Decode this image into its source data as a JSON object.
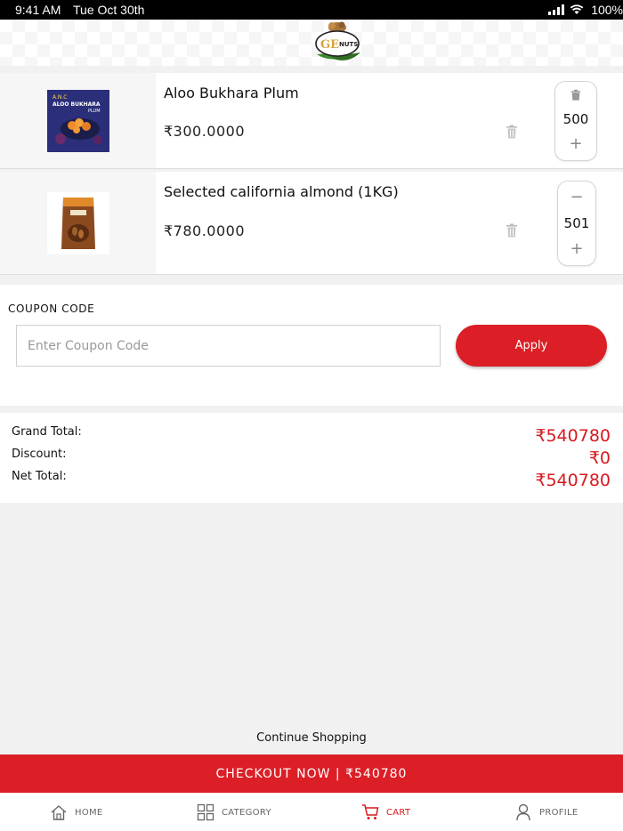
{
  "status_bar": {
    "time": "9:41 AM",
    "date": "Tue Oct 30th",
    "battery": "100%"
  },
  "header": {
    "logo_text": "NUTS"
  },
  "cart": {
    "items": [
      {
        "name": "Aloo Bukhara Plum",
        "price": "₹300.0000",
        "quantity": "500",
        "thumb_text_1": "A.N.C",
        "thumb_text_2": "ALOO BUKHARA",
        "thumb_text_3": "PLUM"
      },
      {
        "name": "Selected california almond (1KG)",
        "price": "₹780.0000",
        "quantity": "501"
      }
    ]
  },
  "coupon": {
    "label": "COUPON CODE",
    "placeholder": "Enter Coupon Code",
    "value": "",
    "apply_label": "Apply"
  },
  "totals": {
    "grand_label": "Grand Total:",
    "grand_value": "₹540780",
    "discount_label": "Discount:",
    "discount_value": "₹0",
    "net_label": "Net Total:",
    "net_value": "₹540780"
  },
  "continue_label": "Continue Shopping",
  "checkout_label": "CHECKOUT NOW | ₹540780",
  "tabs": [
    {
      "label": "HOME"
    },
    {
      "label": "CATEGORY"
    },
    {
      "label": "CART"
    },
    {
      "label": "PROFILE"
    }
  ],
  "colors": {
    "accent": "#dc1f26",
    "price_red": "#d7191f"
  }
}
